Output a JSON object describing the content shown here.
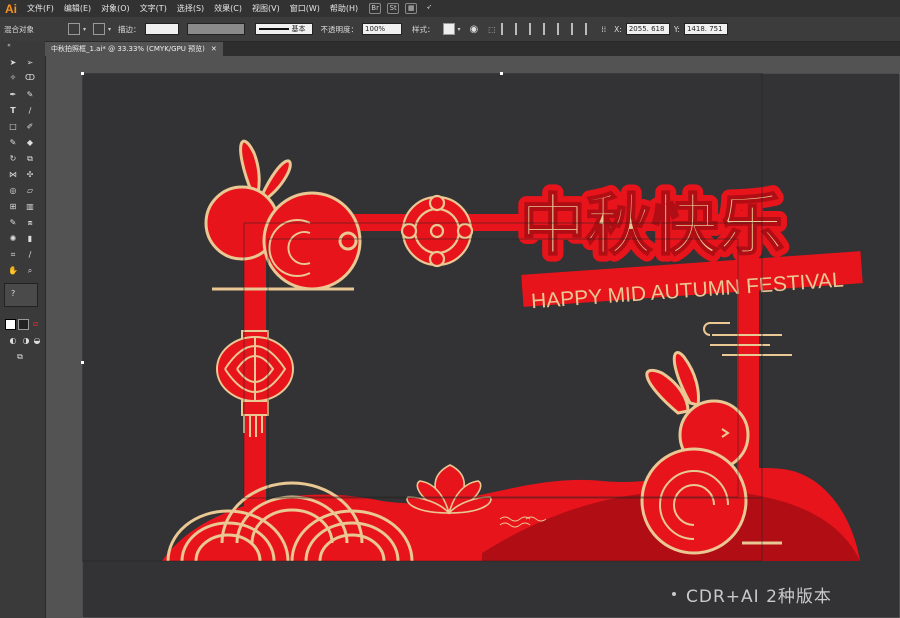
{
  "app": {
    "logo": "Ai"
  },
  "menu": [
    "文件(F)",
    "编辑(E)",
    "对象(O)",
    "文字(T)",
    "选择(S)",
    "效果(C)",
    "视图(V)",
    "窗口(W)",
    "帮助(H)"
  ],
  "menu_icons": {
    "bridge": "Br",
    "stock": "St"
  },
  "control_bar": {
    "selection_label": "混合对象",
    "stroke_label": "描边：",
    "stroke_style": "基本",
    "opacity_label": "不透明度：",
    "opacity_value": "100%",
    "style_label": "样式：",
    "x_label": "X:",
    "x_value": "2055. 618",
    "y_label": "Y:",
    "y_value": "1418. 751"
  },
  "document_tab": {
    "title": "中秋拍照框_1.ai* @ 33.33% (CMYK/GPU 预览)",
    "close": "✕"
  },
  "artwork": {
    "title_cn": "中秋快乐",
    "subtitle_en": "HAPPY MID AUTUMN FESTIVAL",
    "colors": {
      "red": "#e8141c",
      "gold": "#e9c894",
      "dark_red": "#b00e14",
      "canvas": "#333234"
    }
  },
  "watermark": "CDR+AI 2种版本"
}
